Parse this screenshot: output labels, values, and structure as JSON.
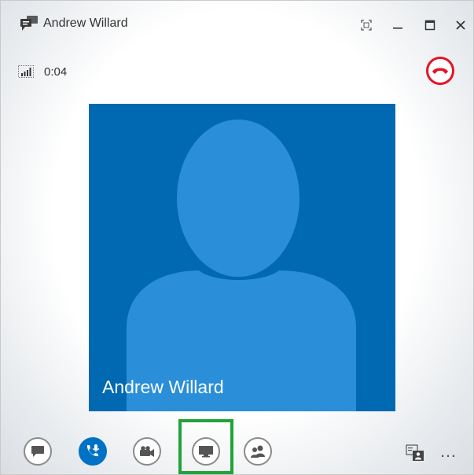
{
  "window": {
    "title": "Andrew Willard"
  },
  "call": {
    "duration": "0:04"
  },
  "participant": {
    "name": "Andrew Willard"
  },
  "toolbar": {
    "more_label": "…"
  },
  "colors": {
    "tile_background": "#0169b2",
    "avatar": "#2a8fd8",
    "hangup_red": "#e81123",
    "audio_active_blue": "#0072c6",
    "highlight_green": "#22a33a"
  },
  "icons": {
    "title": "chat-bubble-icon",
    "signal": "signal-bars-icon",
    "hangup": "phone-hangup-icon",
    "im": "chat-icon",
    "audio": "phone-mic-icon",
    "video": "video-camera-icon",
    "present": "monitor-icon",
    "people": "people-icon",
    "layout": "contact-card-icon"
  }
}
